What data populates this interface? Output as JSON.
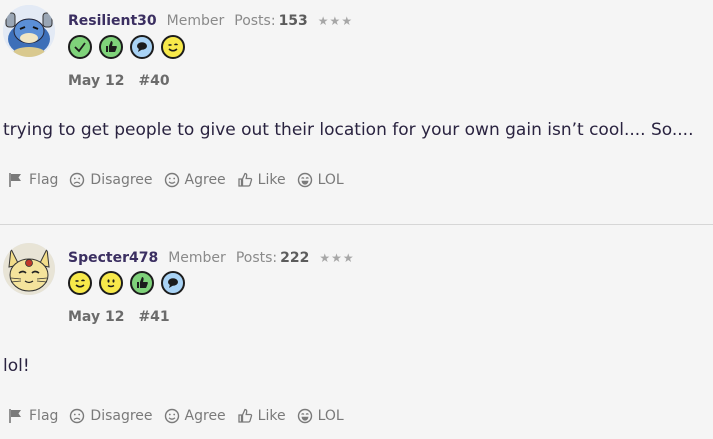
{
  "posts": [
    {
      "username": "Resilient30",
      "role": "Member",
      "posts_label": "Posts:",
      "posts_count": "153",
      "stars": "★★★",
      "badges": [
        "check-badge-icon",
        "thumbs-up-badge-icon",
        "speech-bubble-badge-icon",
        "wink-face-badge-icon"
      ],
      "date": "May 12",
      "post_number": "#40",
      "content": "trying to get people to give out their location for your own gain isn’t cool.... So....",
      "avatar": "blastoise-avatar"
    },
    {
      "username": "Specter478",
      "role": "Member",
      "posts_label": "Posts:",
      "posts_count": "222",
      "stars": "★★★",
      "badges": [
        "wink-face-badge-icon",
        "smile-face-badge-icon",
        "thumbs-up-badge-icon",
        "speech-bubble-badge-icon"
      ],
      "date": "May 12",
      "post_number": "#41",
      "content": "lol!",
      "avatar": "persian-avatar"
    }
  ],
  "actions": {
    "flag": "Flag",
    "disagree": "Disagree",
    "agree": "Agree",
    "like": "Like",
    "lol": "LOL"
  },
  "colors": {
    "background": "#f5f5f5",
    "username": "#3b2f61",
    "muted": "#8a8a8a",
    "badge_green": "#7fd27a",
    "badge_blue": "#a9d3f5",
    "badge_yellow": "#f7e94a"
  }
}
